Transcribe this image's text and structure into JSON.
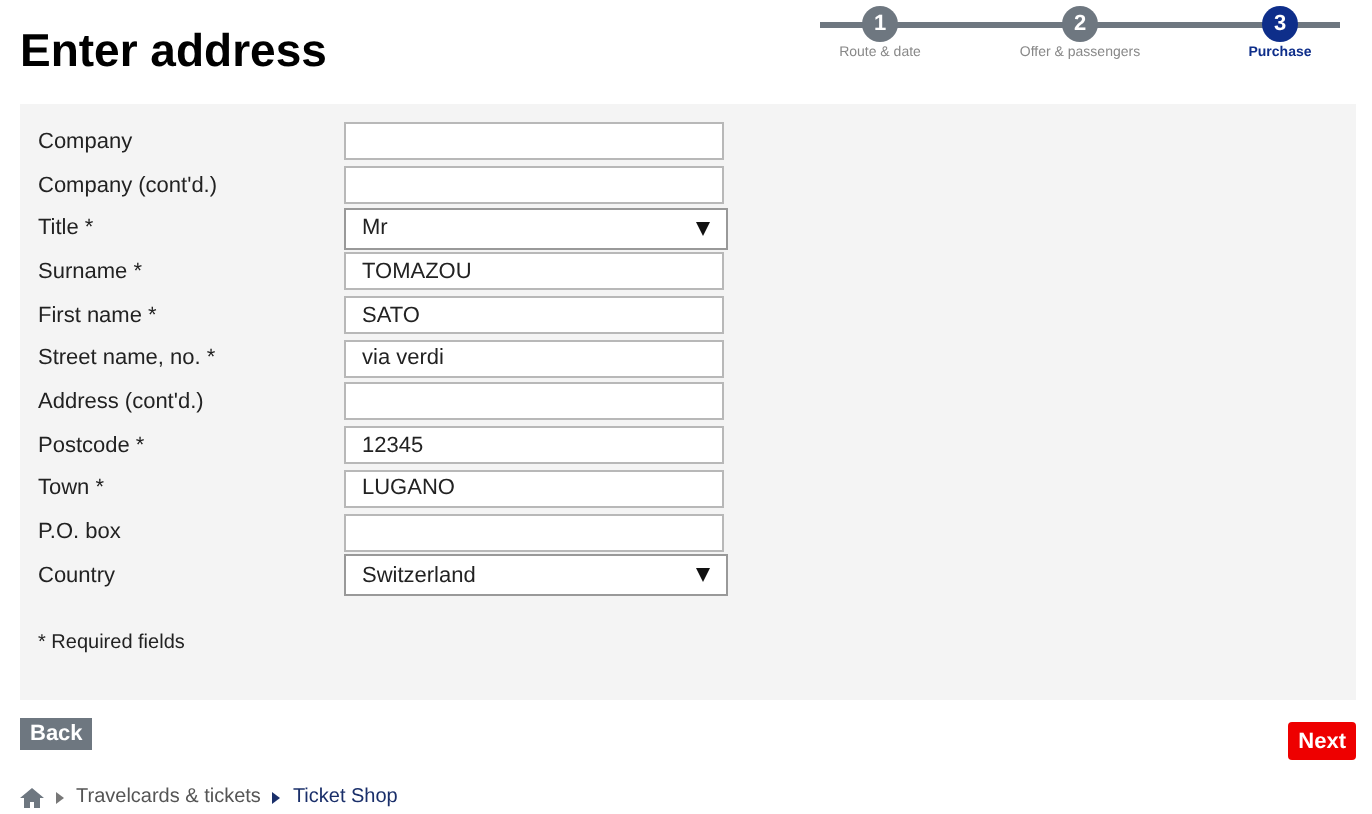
{
  "title": "Enter address",
  "steps": [
    {
      "number": "1",
      "label": "Route & date",
      "selected": false
    },
    {
      "number": "2",
      "label": "Offer & passengers",
      "selected": false
    },
    {
      "number": "3",
      "label": "Purchase",
      "selected": true
    }
  ],
  "fields": [
    {
      "label": "Company",
      "kind": "text"
    },
    {
      "label": "Company (cont'd.)",
      "kind": "text"
    },
    {
      "label": "Title *",
      "kind": "select",
      "value": "Mr"
    },
    {
      "label": "Surname *",
      "kind": "text",
      "value": "TOMAZOU"
    },
    {
      "label": "First name *",
      "kind": "text",
      "value": "SATO"
    },
    {
      "label": "Street name, no. *",
      "kind": "text",
      "value": "via verdi"
    },
    {
      "label": "Address (cont'd.)",
      "kind": "text"
    },
    {
      "label": "Postcode *",
      "kind": "text",
      "value": "12345"
    },
    {
      "label": "Town *",
      "kind": "text",
      "value": "LUGANO"
    },
    {
      "label": "P.O. box",
      "kind": "text"
    },
    {
      "label": "Country",
      "kind": "select",
      "value": "Switzerland"
    }
  ],
  "note": "* Required fields",
  "back_button": "Back",
  "next_button": "Next",
  "breadcrumb": [
    {
      "label": "Travelcards & tickets",
      "selected": false
    },
    {
      "label": "Ticket Shop",
      "selected": true
    }
  ]
}
